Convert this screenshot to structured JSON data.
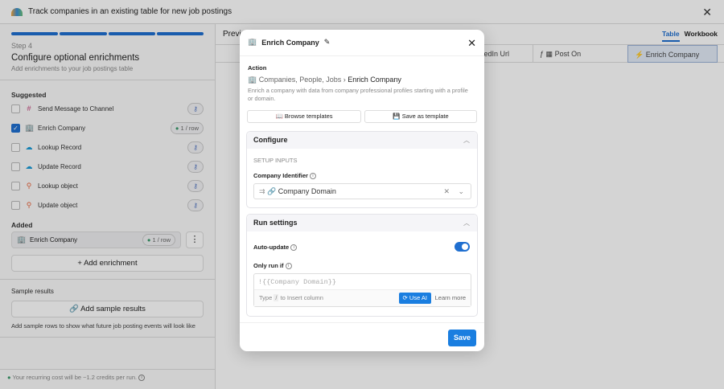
{
  "topbar": {
    "title": "Track companies in an existing table for new job postings",
    "close": "✕"
  },
  "left": {
    "step": "Step 4",
    "heading": "Configure optional enrichments",
    "subheading": "Add enrichments to your job postings table",
    "suggested_label": "Suggested",
    "suggested": [
      {
        "label": "Send Message to Channel",
        "checked": false,
        "icon": "slack-icon",
        "badge": "key"
      },
      {
        "label": "Enrich Company",
        "checked": true,
        "icon": "building-icon",
        "badge": "1 / row"
      },
      {
        "label": "Lookup Record",
        "checked": false,
        "icon": "salesforce-icon",
        "badge": "key"
      },
      {
        "label": "Update Record",
        "checked": false,
        "icon": "salesforce-icon",
        "badge": "key"
      },
      {
        "label": "Lookup object",
        "checked": false,
        "icon": "hubspot-icon",
        "badge": "key"
      },
      {
        "label": "Update object",
        "checked": false,
        "icon": "hubspot-icon",
        "badge": "key"
      }
    ],
    "added_label": "Added",
    "added_item": "Enrich Company",
    "added_badge": "1 / row",
    "add_enrichment": "Add enrichment",
    "sample_label": "Sample results",
    "add_sample": "Add sample results",
    "sample_hint": "Add sample rows to show what future job posting events will look like",
    "footer": "Your recurring cost will be ~1.2 credits per run."
  },
  "right": {
    "preview": "Previ",
    "tabs": [
      "Table",
      "Workbook"
    ],
    "columns": [
      "kedIn Url",
      "Post On",
      "Enrich Company"
    ]
  },
  "modal": {
    "title": "Enrich Company",
    "action_label": "Action",
    "crumb_parent": "Companies, People, Jobs",
    "crumb_current": "Enrich Company",
    "description": "Enrich a company with data from company professional profiles starting with a profile or domain.",
    "browse": "Browse templates",
    "save_template": "Save as template",
    "configure": "Configure",
    "setup_inputs": "SETUP INPUTS",
    "company_identifier": "Company Identifier",
    "identifier_value": "Company Domain",
    "run_settings": "Run settings",
    "auto_update": "Auto-update",
    "auto_update_on": true,
    "only_run_if": "Only run if",
    "condition": "!{{Company Domain}}",
    "hint_type": "Type",
    "hint_key": "/",
    "hint_rest": "to Insert column",
    "use_ai": "Use AI",
    "learn_more": "Learn more",
    "save": "Save"
  }
}
